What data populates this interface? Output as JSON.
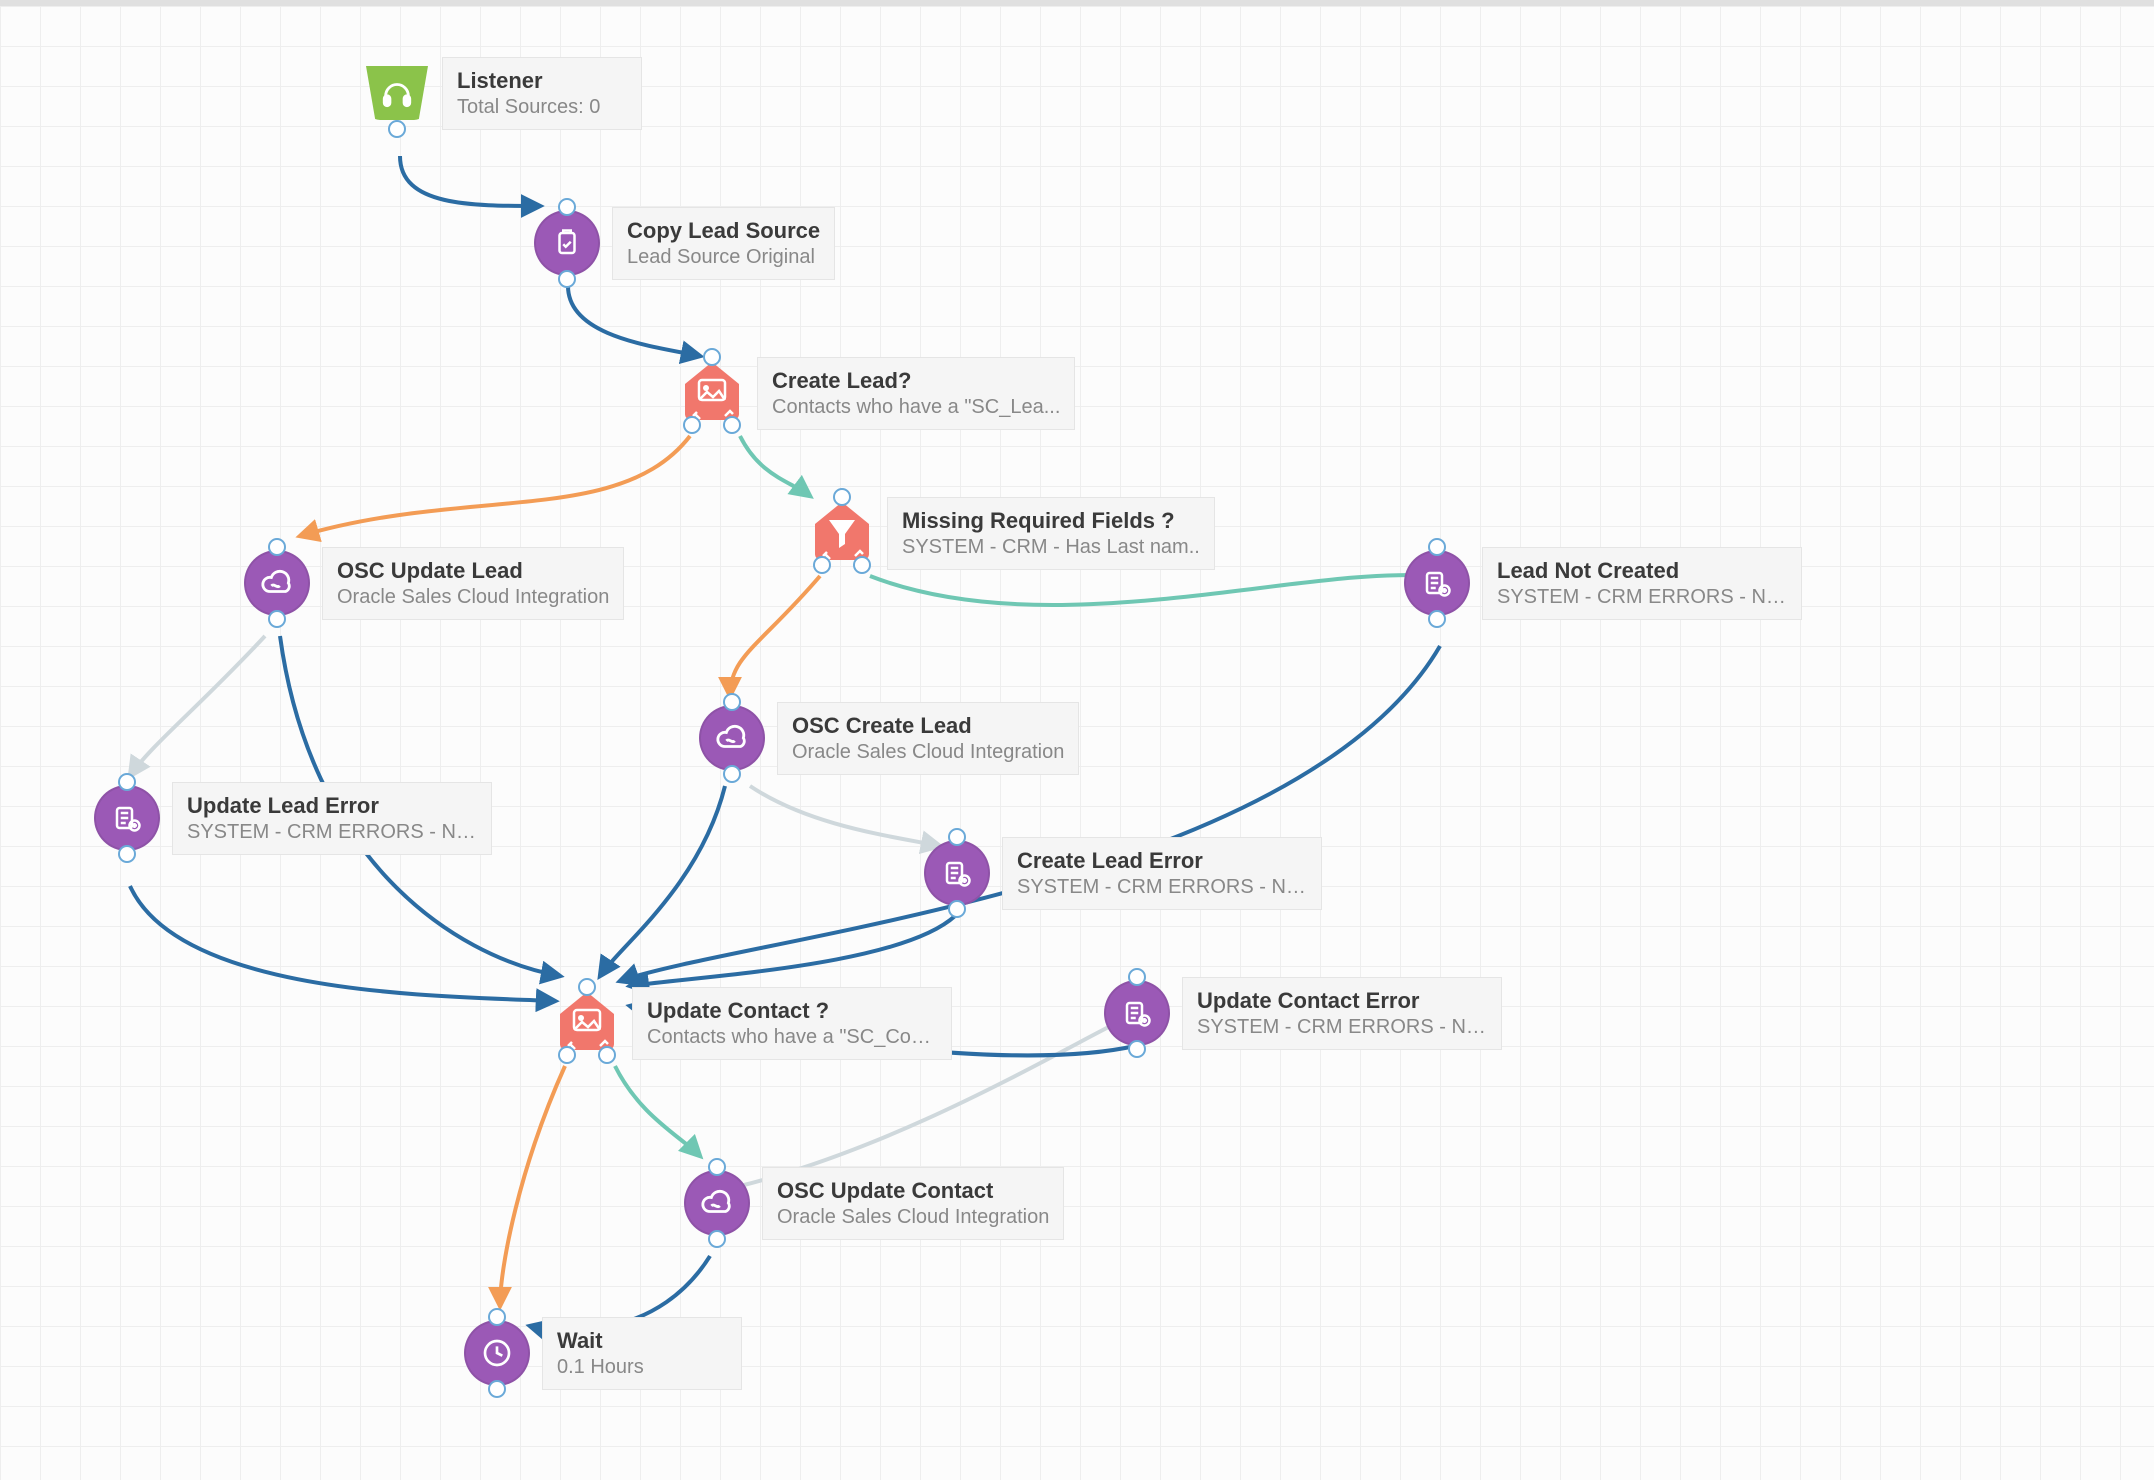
{
  "nodes": {
    "listener": {
      "title": "Listener",
      "sub": "Total Sources: 0"
    },
    "copyLead": {
      "title": "Copy Lead Source",
      "sub": "Lead Source Original"
    },
    "createLeadQ": {
      "title": "Create Lead?",
      "sub": "Contacts who have a \"SC_Lea..."
    },
    "missingFields": {
      "title": "Missing Required Fields ?",
      "sub": "SYSTEM - CRM - Has Last nam.."
    },
    "oscUpdateLead": {
      "title": "OSC Update Lead",
      "sub": "Oracle Sales Cloud Integration"
    },
    "leadNotCreated": {
      "title": "Lead Not Created",
      "sub": "SYSTEM - CRM ERRORS - No La"
    },
    "oscCreateLead": {
      "title": "OSC Create Lead",
      "sub": "Oracle Sales Cloud Integration"
    },
    "updateLeadError": {
      "title": "Update Lead Error",
      "sub": "SYSTEM - CRM ERRORS - No La"
    },
    "createLeadError": {
      "title": "Create Lead Error",
      "sub": "SYSTEM - CRM ERRORS - No La"
    },
    "updateContactQ": {
      "title": "Update Contact ?",
      "sub": "Contacts who have a \"SC_Con..."
    },
    "updateContactErr": {
      "title": "Update Contact Error",
      "sub": "SYSTEM - CRM ERRORS - No La"
    },
    "oscUpdateContact": {
      "title": "OSC Update Contact",
      "sub": "Oracle Sales Cloud Integration"
    },
    "wait": {
      "title": "Wait",
      "sub": "0.1 Hours"
    }
  },
  "colors": {
    "blue": "#2b6ca3",
    "orange": "#f39c55",
    "teal": "#6fc7b3",
    "purple": "#9b6fb7",
    "green": "#8cc152",
    "coral": "#f1776c",
    "grey": "#cfd8dc"
  }
}
